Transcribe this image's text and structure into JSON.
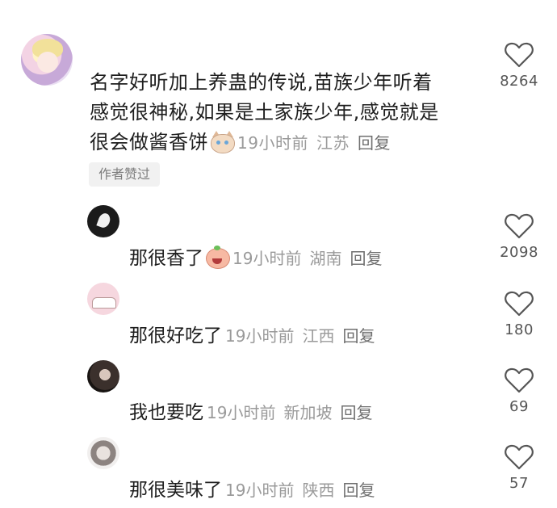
{
  "main_comment": {
    "lines": [
      "名字好听加上养蛊的传说,苗族少年听着",
      "感觉很神秘,如果是土家族少年,感觉就是",
      "很会做酱香饼"
    ],
    "emoji": "cat-face-emoji",
    "time": "19小时前",
    "location": "江苏",
    "reply_label": "回复",
    "author_liked": "作者赞过",
    "likes": "8264"
  },
  "replies": [
    {
      "text": "那很香了",
      "emoji": "peach-face-emoji",
      "time": "19小时前",
      "location": "湖南",
      "reply_label": "回复",
      "likes": "2098"
    },
    {
      "text": "那很好吃了",
      "time": "19小时前",
      "location": "江西",
      "reply_label": "回复",
      "likes": "180"
    },
    {
      "text": "我也要吃",
      "time": "19小时前",
      "location": "新加坡",
      "reply_label": "回复",
      "likes": "69"
    },
    {
      "text": "那很美味了",
      "time": "19小时前",
      "location": "陕西",
      "reply_label": "回复",
      "likes": "57"
    }
  ],
  "icons": {
    "like": "heart-outline-icon"
  },
  "colors": {
    "text": "#1e1e1e",
    "meta": "#9a9a9a",
    "badge_bg": "#f1f1f1"
  }
}
